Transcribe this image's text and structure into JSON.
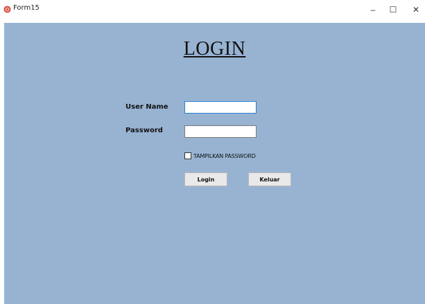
{
  "window": {
    "title": "Form15",
    "icon": "app-icon",
    "controls": {
      "minimize": "–",
      "maximize": "☐",
      "close": "✕"
    }
  },
  "form": {
    "heading": "LOGIN",
    "username_label": "User Name",
    "username_value": "",
    "password_label": "Password",
    "password_value": "",
    "show_password_label": "TAMPILKAN PASSWORD",
    "show_password_checked": false,
    "login_button": "Login",
    "exit_button": "Keluar"
  },
  "colors": {
    "client_background": "#98b3d2",
    "focus_border": "#2a7fd4"
  }
}
